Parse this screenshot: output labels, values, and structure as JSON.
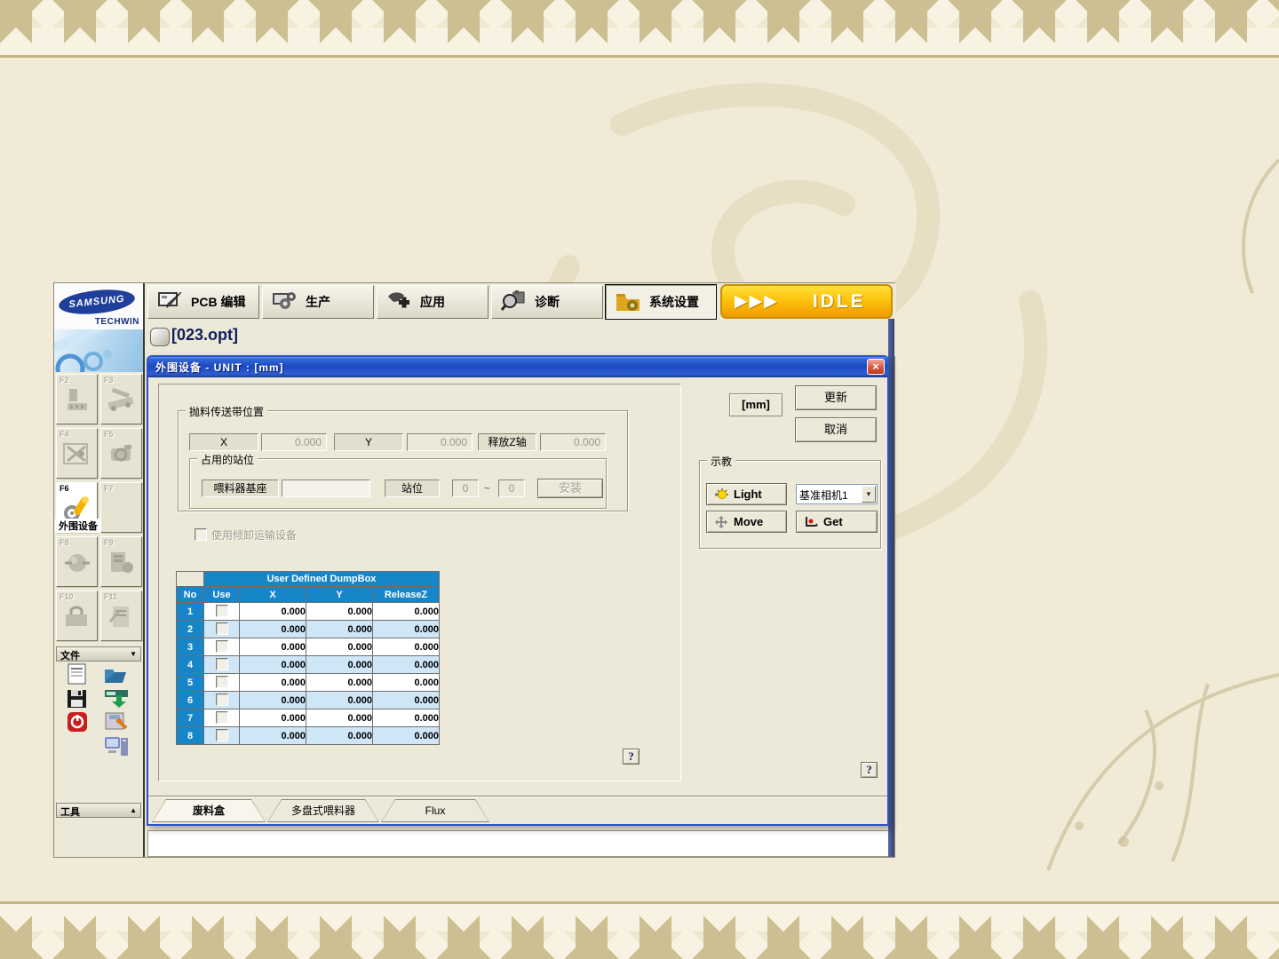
{
  "colors": {
    "table_header": "#1686c8",
    "row_alt": "#cfe6f7",
    "idle_yellow": "#fdc30d",
    "title_blue": "#1c49c0",
    "window_bg": "#ece9d8"
  },
  "sidebar": {
    "logo": {
      "brand": "SAMSUNG",
      "sub": "TECHWIN"
    },
    "fkeys": [
      {
        "key": "F2"
      },
      {
        "key": "F3"
      },
      {
        "key": "F4"
      },
      {
        "key": "F5"
      },
      {
        "key": "F6",
        "label": "外围设备"
      },
      {
        "key": "F7"
      },
      {
        "key": "F8"
      },
      {
        "key": "F9"
      },
      {
        "key": "F10"
      },
      {
        "key": "F11"
      }
    ],
    "file_section": {
      "label": "文件",
      "arrow": "▼"
    },
    "tool_section": {
      "label": "工具",
      "arrow": "▲"
    }
  },
  "toolbar": {
    "buttons": [
      {
        "label": "PCB 编辑"
      },
      {
        "label": "生产"
      },
      {
        "label": "应用"
      },
      {
        "label": "诊断"
      },
      {
        "label": "系统设置"
      }
    ],
    "arrows": "▶▶▶",
    "status": "IDLE"
  },
  "file_bar": {
    "label": "[023.opt]"
  },
  "dialog": {
    "title": "外围设备 - UNIT : [mm]",
    "close": "×",
    "conveyor": {
      "title": "抛料传送带位置",
      "x_label": "X",
      "x_value": "0.000",
      "y_label": "Y",
      "y_value": "0.000",
      "z_label": "释放Z轴",
      "z_value": "0.000"
    },
    "station": {
      "title": "占用的站位",
      "feeder_label": "喂料器基座",
      "feeder_value": "",
      "slot_label": "站位",
      "from": "0",
      "tilde": "~",
      "to": "0",
      "install": "安装"
    },
    "tilt_checkbox": "使用倾卸运输设备",
    "table": {
      "group_header": "User Defined DumpBox",
      "columns": [
        "No",
        "Use",
        "X",
        "Y",
        "ReleaseZ"
      ],
      "rows": [
        {
          "no": "1",
          "x": "0.000",
          "y": "0.000",
          "z": "0.000"
        },
        {
          "no": "2",
          "x": "0.000",
          "y": "0.000",
          "z": "0.000"
        },
        {
          "no": "3",
          "x": "0.000",
          "y": "0.000",
          "z": "0.000"
        },
        {
          "no": "4",
          "x": "0.000",
          "y": "0.000",
          "z": "0.000"
        },
        {
          "no": "5",
          "x": "0.000",
          "y": "0.000",
          "z": "0.000"
        },
        {
          "no": "6",
          "x": "0.000",
          "y": "0.000",
          "z": "0.000"
        },
        {
          "no": "7",
          "x": "0.000",
          "y": "0.000",
          "z": "0.000"
        },
        {
          "no": "8",
          "x": "0.000",
          "y": "0.000",
          "z": "0.000"
        }
      ]
    },
    "unit": "[mm]",
    "update": "更新",
    "cancel": "取消",
    "help": "?",
    "teach": {
      "title": "示教",
      "light": "Light",
      "camera": "基准相机1",
      "move": "Move",
      "get": "Get",
      "dd_arrow": "▼"
    },
    "tabs": [
      {
        "label": "废料盒"
      },
      {
        "label": "多盘式喂料器"
      },
      {
        "label": "Flux"
      }
    ]
  }
}
